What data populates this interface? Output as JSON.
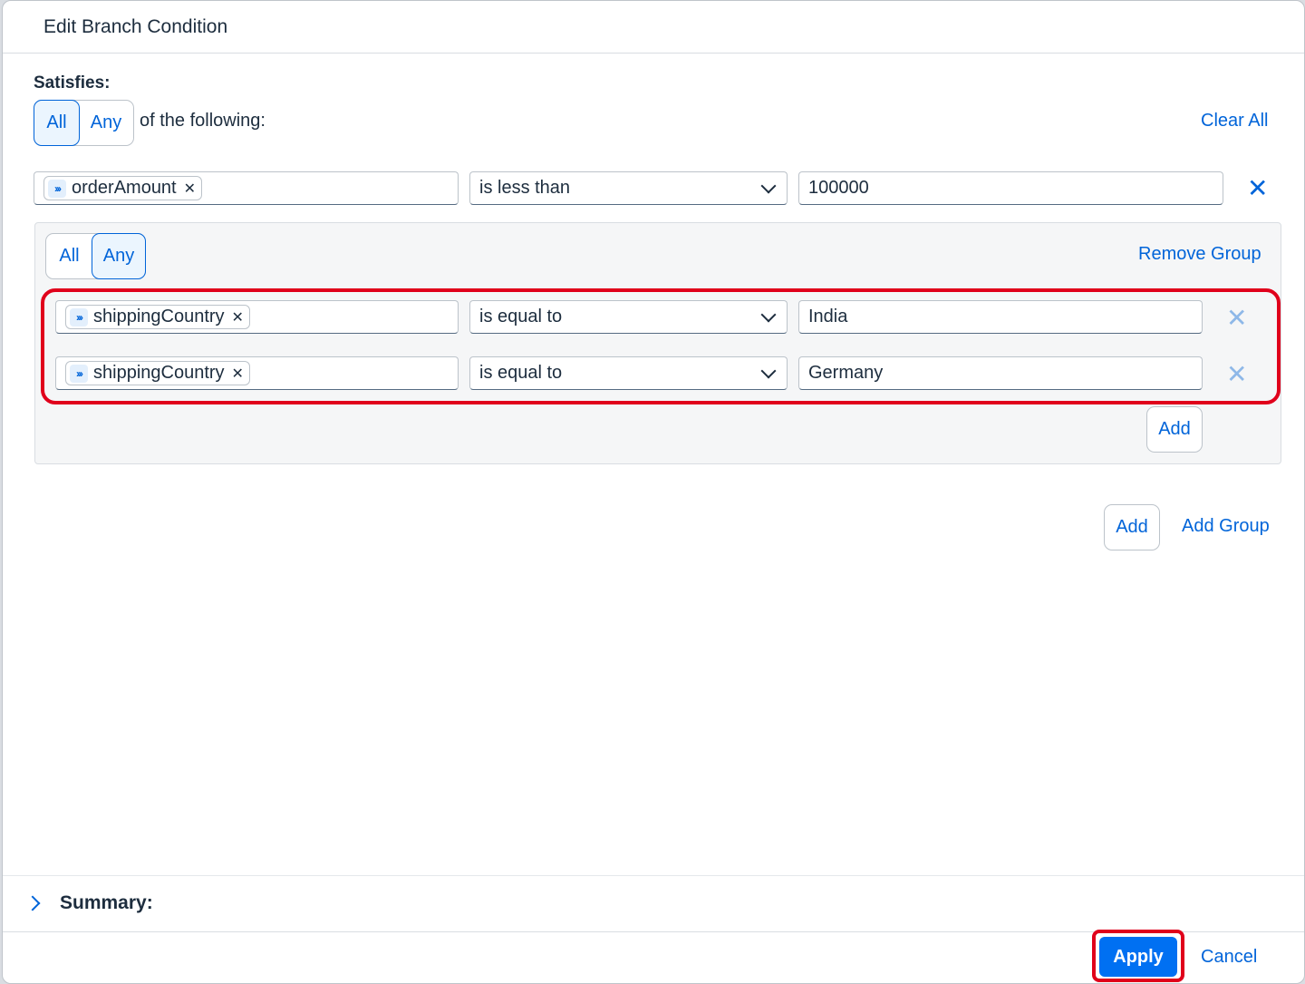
{
  "dialog": {
    "title": "Edit Branch Condition"
  },
  "condition": {
    "satisfies_label": "Satisfies:",
    "mode_options": [
      "All",
      "Any"
    ],
    "selected_mode": "All",
    "following_text": "of the following:",
    "clear_all_label": "Clear All",
    "rows": [
      {
        "field": "orderAmount",
        "operator": "is less than",
        "value": "100000"
      }
    ],
    "group": {
      "mode_options": [
        "All",
        "Any"
      ],
      "selected_mode": "Any",
      "remove_label": "Remove Group",
      "rows": [
        {
          "field": "shippingCountry",
          "operator": "is equal to",
          "value": "India"
        },
        {
          "field": "shippingCountry",
          "operator": "is equal to",
          "value": "Germany"
        }
      ],
      "add_label": "Add"
    },
    "add_label": "Add",
    "add_group_label": "Add Group"
  },
  "summary": {
    "label": "Summary:"
  },
  "footer": {
    "apply_label": "Apply",
    "cancel_label": "Cancel"
  },
  "colors": {
    "accent": "#0064d9",
    "apply_bg": "#0070f2",
    "highlight": "#e0001b"
  },
  "icons": {
    "token": "expression-icon",
    "remove": "close-icon",
    "dropdown": "chevron-down-icon",
    "expand": "chevron-right-icon"
  }
}
